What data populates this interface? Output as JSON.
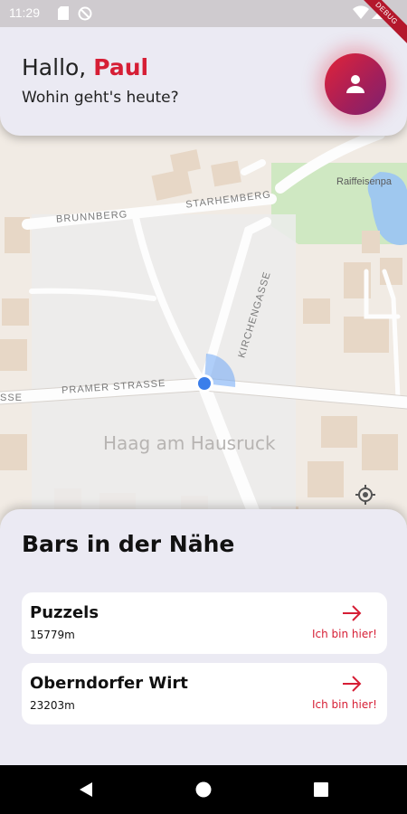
{
  "status_bar": {
    "time": "11:29",
    "icons": [
      "sd-card-icon",
      "no-disturb-icon",
      "wifi-icon",
      "signal-icon",
      "battery-icon"
    ],
    "debug_label": "DEBUG"
  },
  "header": {
    "greeting_prefix": "Hallo,",
    "user_name": "Paul",
    "subtitle": "Wohin geht's heute?",
    "avatar_icon": "person-icon",
    "accent_color": "#d61e35"
  },
  "map": {
    "streets": [
      "BRUNNBERG",
      "STARHEMBERG",
      "KIRCHENGASSE",
      "PRAMER STRASSE",
      "SSE"
    ],
    "town_label": "Haag am Hausruck",
    "park_label": "Raiffeisenpa",
    "locate_icon": "my-location-icon"
  },
  "bars_sheet": {
    "title": "Bars in der Nähe",
    "items": [
      {
        "name": "Puzzels",
        "distance": "15779m",
        "action": "Ich bin hier!",
        "icon": "arrow-right-icon"
      },
      {
        "name": "Oberndorfer Wirt",
        "distance": "23203m",
        "action": "Ich bin hier!",
        "icon": "arrow-right-icon"
      }
    ]
  },
  "nav_bar": {
    "buttons": [
      "back-icon",
      "home-icon",
      "recents-icon"
    ]
  }
}
